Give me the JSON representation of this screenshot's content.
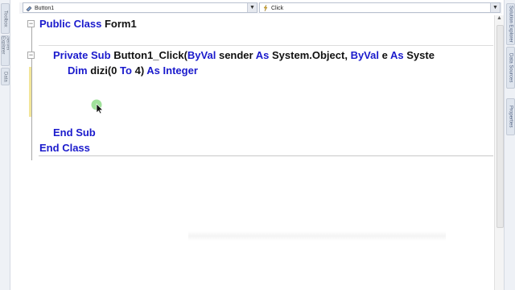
{
  "side_tabs": {
    "left": [
      "Toolbox",
      "Server Explorer",
      "Data"
    ],
    "right": [
      "Solution Explorer",
      "Data Sources",
      "Properties"
    ]
  },
  "dropdowns": {
    "object_value": "Button1",
    "event_value": "Click"
  },
  "code": {
    "line1": {
      "kw1": "Public",
      "kw2": "Class",
      "name": "Form1"
    },
    "line2": {
      "kw1": "Private",
      "kw2": "Sub",
      "name": "Button1_Click(",
      "kw3": "ByVal",
      "p1": "sender",
      "kw4": "As",
      "t1": "System.Object,",
      "kw5": "ByVal",
      "p2": "e",
      "kw6": "As",
      "t2": "Syste"
    },
    "line3": {
      "kw1": "Dim",
      "mid": "dizi(0",
      "kw2": "To",
      "mid2": "4)",
      "kw3": "As",
      "kw4": "Integer"
    },
    "line4": {
      "kw1": "End",
      "kw2": "Sub"
    },
    "line5": {
      "kw1": "End",
      "kw2": "Class"
    }
  },
  "colors": {
    "keyword": "#1a1acc",
    "text": "#111111"
  }
}
